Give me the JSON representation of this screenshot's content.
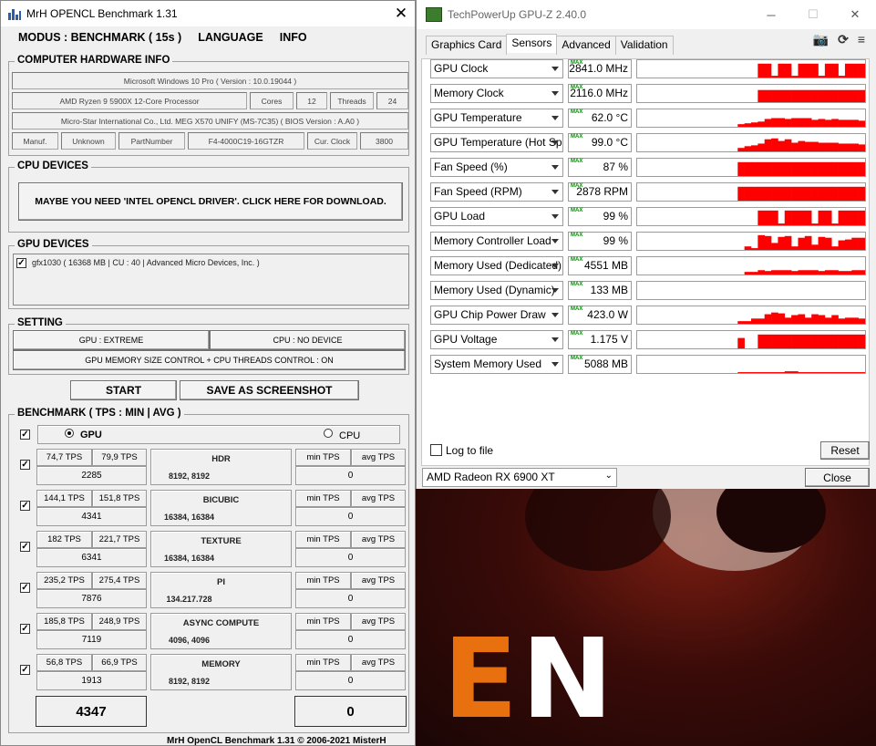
{
  "mrh": {
    "title": "MrH OPENCL Benchmark 1.31",
    "menu": [
      "MODUS : BENCHMARK ( 15s )",
      "LANGUAGE",
      "INFO"
    ],
    "hardware": {
      "title": "COMPUTER HARDWARE INFO",
      "os": "Microsoft Windows 10 Pro ( Version : 10.0.19044 )",
      "cpu": "AMD Ryzen 9 5900X 12-Core Processor",
      "cores_label": "Cores",
      "cores": "12",
      "threads_label": "Threads",
      "threads": "24",
      "board": "Micro-Star International Co., Ltd. MEG X570 UNIFY (MS-7C35) ( BIOS Version : A.A0 )",
      "manuf_label": "Manuf.",
      "manuf": "Unknown",
      "part_label": "PartNumber",
      "part": "F4-4000C19-16GTZR",
      "clock_label": "Cur. Clock",
      "clock": "3800"
    },
    "cpu_devices": {
      "title": "CPU DEVICES",
      "button": "MAYBE YOU NEED 'INTEL OPENCL DRIVER'. CLICK HERE FOR DOWNLOAD."
    },
    "gpu_devices": {
      "title": "GPU DEVICES",
      "item": "gfx1030 ( 16368 MB | CU : 40 | Advanced Micro Devices, Inc. )",
      "check": "✓"
    },
    "setting": {
      "title": "SETTING",
      "gpu": "GPU : EXTREME",
      "cpu": "CPU : NO DEVICE",
      "memory": "GPU MEMORY SIZE CONTROL + CPU THREADS CONTROL : ON"
    },
    "start": "START",
    "screenshot": "SAVE AS SCREENSHOT",
    "benchmark": {
      "title": "BENCHMARK ( TPS : MIN | AVG )",
      "gpu_label": "GPU",
      "cpu_label": "CPU",
      "min_label": "min TPS",
      "avg_label": "avg TPS",
      "rows": [
        {
          "min": "74,7 TPS",
          "avg": "79,9 TPS",
          "score": "2285",
          "name": "HDR",
          "size": "8192, 8192",
          "cpu": "0"
        },
        {
          "min": "144,1 TPS",
          "avg": "151,8 TPS",
          "score": "4341",
          "name": "BICUBIC",
          "size": "16384, 16384",
          "cpu": "0"
        },
        {
          "min": "182 TPS",
          "avg": "221,7 TPS",
          "score": "6341",
          "name": "TEXTURE",
          "size": "16384, 16384",
          "cpu": "0"
        },
        {
          "min": "235,2 TPS",
          "avg": "275,4 TPS",
          "score": "7876",
          "name": "PI",
          "size": "134.217.728",
          "cpu": "0"
        },
        {
          "min": "185,8 TPS",
          "avg": "248,9 TPS",
          "score": "7119",
          "name": "ASYNC COMPUTE",
          "size": "4096, 4096",
          "cpu": "0"
        },
        {
          "min": "56,8 TPS",
          "avg": "66,9 TPS",
          "score": "1913",
          "name": "MEMORY",
          "size": "8192, 8192",
          "cpu": "0"
        }
      ],
      "total_gpu": "4347",
      "total_cpu": "0"
    },
    "footer": "MrH OpenCL Benchmark 1.31  ©  2006-2021 MisterH"
  },
  "gpuz": {
    "title": "TechPowerUp GPU-Z 2.40.0",
    "tabs": [
      "Graphics Card",
      "Sensors",
      "Advanced",
      "Validation"
    ],
    "max_tag": "MAX",
    "sensors": [
      {
        "name": "GPU Clock",
        "value": "2841.0 MHz",
        "profile": [
          0,
          0,
          0,
          0,
          0,
          0,
          0,
          0,
          0,
          0,
          0,
          0,
          0,
          0,
          0,
          0,
          0,
          0,
          0.8,
          0.8,
          0.1,
          0.8,
          0.8,
          0.1,
          0.8,
          0.8,
          0.8,
          0.1,
          0.8,
          0.8,
          0.1,
          0.8,
          0.8,
          0.8
        ]
      },
      {
        "name": "Memory Clock",
        "value": "2116.0 MHz",
        "profile": [
          0,
          0,
          0,
          0,
          0,
          0,
          0,
          0,
          0,
          0,
          0,
          0,
          0,
          0,
          0,
          0,
          0,
          0,
          0.7,
          0.7,
          0.7,
          0.7,
          0.7,
          0.7,
          0.7,
          0.7,
          0.7,
          0.7,
          0.7,
          0.7,
          0.7,
          0.7,
          0.7,
          0.7
        ]
      },
      {
        "name": "GPU Temperature",
        "value": "62.0 °C",
        "profile": [
          0,
          0,
          0,
          0,
          0,
          0,
          0,
          0,
          0,
          0,
          0,
          0,
          0,
          0,
          0,
          0.15,
          0.2,
          0.25,
          0.3,
          0.45,
          0.5,
          0.5,
          0.45,
          0.5,
          0.5,
          0.5,
          0.4,
          0.45,
          0.4,
          0.45,
          0.4,
          0.4,
          0.4,
          0.35
        ]
      },
      {
        "name": "GPU Temperature (Hot Spot)",
        "value": "99.0 °C",
        "profile": [
          0,
          0,
          0,
          0,
          0,
          0,
          0,
          0,
          0,
          0,
          0,
          0,
          0,
          0,
          0,
          0.2,
          0.3,
          0.35,
          0.45,
          0.7,
          0.75,
          0.6,
          0.7,
          0.5,
          0.6,
          0.55,
          0.55,
          0.5,
          0.5,
          0.5,
          0.45,
          0.45,
          0.45,
          0.4
        ]
      },
      {
        "name": "Fan Speed (%)",
        "value": "87 %",
        "profile": [
          0,
          0,
          0,
          0,
          0,
          0,
          0,
          0,
          0,
          0,
          0,
          0,
          0,
          0,
          0,
          0.8,
          0.8,
          0.8,
          0.8,
          0.8,
          0.8,
          0.8,
          0.8,
          0.8,
          0.8,
          0.8,
          0.8,
          0.8,
          0.8,
          0.8,
          0.8,
          0.8,
          0.8,
          0.8
        ]
      },
      {
        "name": "Fan Speed (RPM)",
        "value": "2878 RPM",
        "profile": [
          0,
          0,
          0,
          0,
          0,
          0,
          0,
          0,
          0,
          0,
          0,
          0,
          0,
          0,
          0,
          0.8,
          0.8,
          0.8,
          0.8,
          0.8,
          0.8,
          0.8,
          0.8,
          0.8,
          0.8,
          0.8,
          0.8,
          0.8,
          0.8,
          0.8,
          0.8,
          0.8,
          0.8,
          0.8
        ]
      },
      {
        "name": "GPU Load",
        "value": "99 %",
        "profile": [
          0,
          0,
          0,
          0,
          0,
          0,
          0,
          0,
          0,
          0,
          0,
          0,
          0,
          0,
          0,
          0,
          0,
          0,
          0.85,
          0.85,
          0.85,
          0.1,
          0.85,
          0.85,
          0.85,
          0.85,
          0.1,
          0.85,
          0.85,
          0.1,
          0.85,
          0.85,
          0.85,
          0.85
        ]
      },
      {
        "name": "Memory Controller Load",
        "value": "99 %",
        "profile": [
          0,
          0,
          0,
          0,
          0,
          0,
          0,
          0,
          0,
          0,
          0,
          0,
          0,
          0,
          0,
          0,
          0.2,
          0.1,
          0.85,
          0.8,
          0.4,
          0.75,
          0.8,
          0.2,
          0.7,
          0.8,
          0.3,
          0.75,
          0.7,
          0.2,
          0.55,
          0.6,
          0.7,
          0.7
        ]
      },
      {
        "name": "Memory Used (Dedicated)",
        "value": "4551 MB",
        "profile": [
          0,
          0,
          0,
          0,
          0,
          0,
          0,
          0,
          0,
          0,
          0,
          0,
          0,
          0,
          0,
          0,
          0.15,
          0.15,
          0.25,
          0.2,
          0.25,
          0.25,
          0.25,
          0.2,
          0.25,
          0.25,
          0.25,
          0.2,
          0.25,
          0.25,
          0.2,
          0.2,
          0.25,
          0.25
        ]
      },
      {
        "name": "Memory Used (Dynamic)",
        "value": "133 MB",
        "profile": [
          0,
          0,
          0,
          0,
          0,
          0,
          0,
          0,
          0,
          0,
          0,
          0,
          0,
          0,
          0,
          0,
          0,
          0,
          0,
          0,
          0,
          0,
          0,
          0,
          0,
          0,
          0,
          0,
          0,
          0,
          0,
          0,
          0,
          0
        ]
      },
      {
        "name": "GPU Chip Power Draw",
        "value": "423.0 W",
        "profile": [
          0,
          0,
          0,
          0,
          0,
          0,
          0,
          0,
          0,
          0,
          0,
          0,
          0,
          0,
          0,
          0.15,
          0.15,
          0.3,
          0.3,
          0.55,
          0.65,
          0.6,
          0.35,
          0.5,
          0.55,
          0.35,
          0.55,
          0.5,
          0.35,
          0.5,
          0.3,
          0.35,
          0.35,
          0.3
        ]
      },
      {
        "name": "GPU Voltage",
        "value": "1.175 V",
        "profile": [
          0,
          0,
          0,
          0,
          0,
          0,
          0,
          0,
          0,
          0,
          0,
          0,
          0,
          0,
          0,
          0.6,
          0,
          0,
          0.8,
          0.8,
          0.8,
          0.8,
          0.8,
          0.8,
          0.8,
          0.8,
          0.8,
          0.8,
          0.8,
          0.8,
          0.8,
          0.8,
          0.8,
          0.8
        ]
      },
      {
        "name": "System Memory Used",
        "value": "5088 MB",
        "profile": [
          0,
          0,
          0,
          0,
          0,
          0,
          0,
          0,
          0,
          0,
          0,
          0,
          0,
          0,
          0,
          0.05,
          0.05,
          0.05,
          0.05,
          0.05,
          0.05,
          0.05,
          0.1,
          0.1,
          0.05,
          0.05,
          0.05,
          0.05,
          0.05,
          0.05,
          0.05,
          0.05,
          0.05,
          0.05
        ]
      }
    ],
    "log_label": "Log to file",
    "reset": "Reset",
    "device": "AMD Radeon RX 6900 XT",
    "close": "Close"
  },
  "desktop": {
    "brand_orange": "E",
    "brand_white": "N"
  },
  "colors": {
    "graph_red": "#ff0000"
  }
}
